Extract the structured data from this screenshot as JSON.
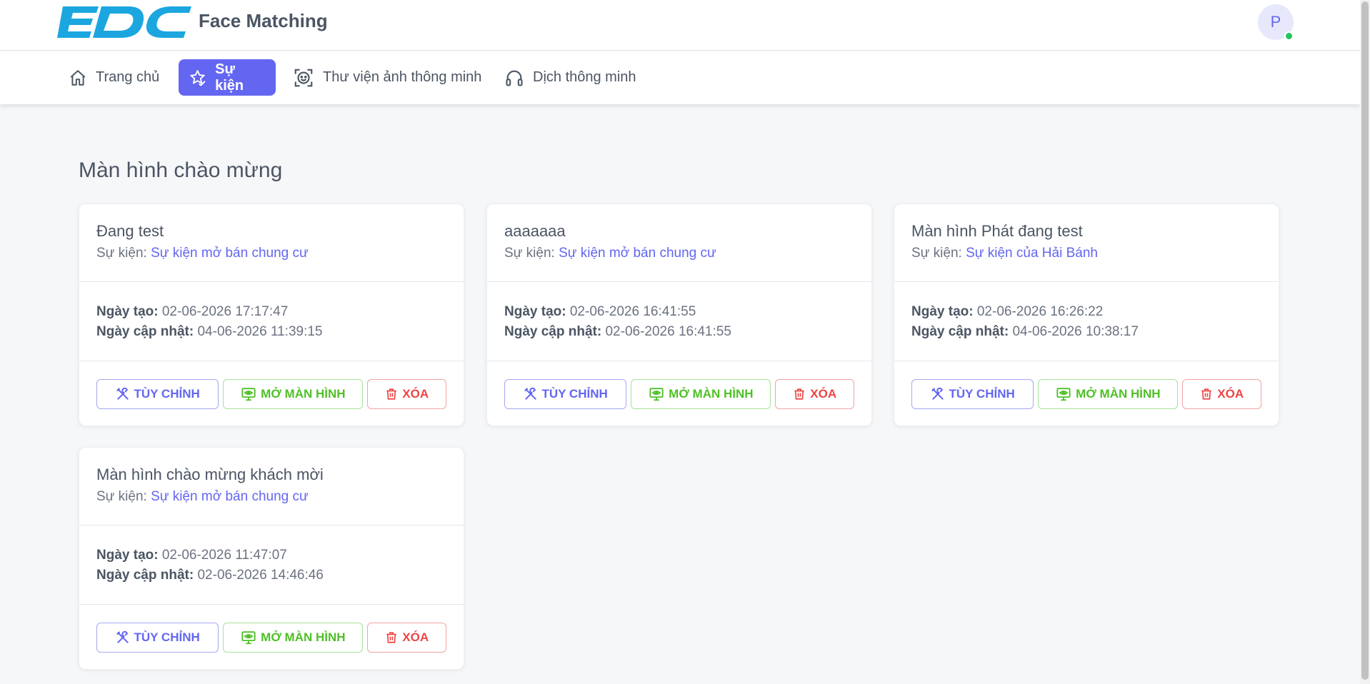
{
  "header": {
    "logo_text": "EDC",
    "app_title": "Face Matching",
    "avatar_initial": "P"
  },
  "nav": {
    "items": [
      {
        "label": "Trang chủ",
        "icon": "home-icon",
        "active": false
      },
      {
        "label": "Sự kiện",
        "icon": "star-check-icon",
        "active": true
      },
      {
        "label": "Thư viện ảnh thông minh",
        "icon": "face-scan-icon",
        "active": false
      },
      {
        "label": "Dịch thông minh",
        "icon": "headphones-icon",
        "active": false
      }
    ]
  },
  "main": {
    "title": "Màn hình chào mừng",
    "labels": {
      "event": "Sự kiện:",
      "created": "Ngày tạo:",
      "updated": "Ngày cập nhật:"
    },
    "actions": {
      "customize": "TÙY CHỈNH",
      "open_screen": "MỞ MÀN HÌNH",
      "delete": "XÓA"
    },
    "cards": [
      {
        "title": "Đang test",
        "event": "Sự kiện mở bán chung cư",
        "created": "02-06-2026 17:17:47",
        "updated": "04-06-2026 11:39:15"
      },
      {
        "title": "aaaaaaa",
        "event": "Sự kiện mở bán chung cư",
        "created": "02-06-2026 16:41:55",
        "updated": "02-06-2026 16:41:55"
      },
      {
        "title": "Màn hình Phát đang test",
        "event": "Sự kiện của Hải Bánh",
        "created": "02-06-2026 16:26:22",
        "updated": "04-06-2026 10:38:17"
      },
      {
        "title": "Màn hình chào mừng khách mời",
        "event": "Sự kiện mở bán chung cư",
        "created": "02-06-2026 11:47:07",
        "updated": "02-06-2026 14:46:46"
      }
    ]
  },
  "colors": {
    "primary": "#6366f1",
    "success": "#4fc027",
    "danger": "#ef4444",
    "logo": "#1ca6e0",
    "background": "#f6f7f9"
  }
}
